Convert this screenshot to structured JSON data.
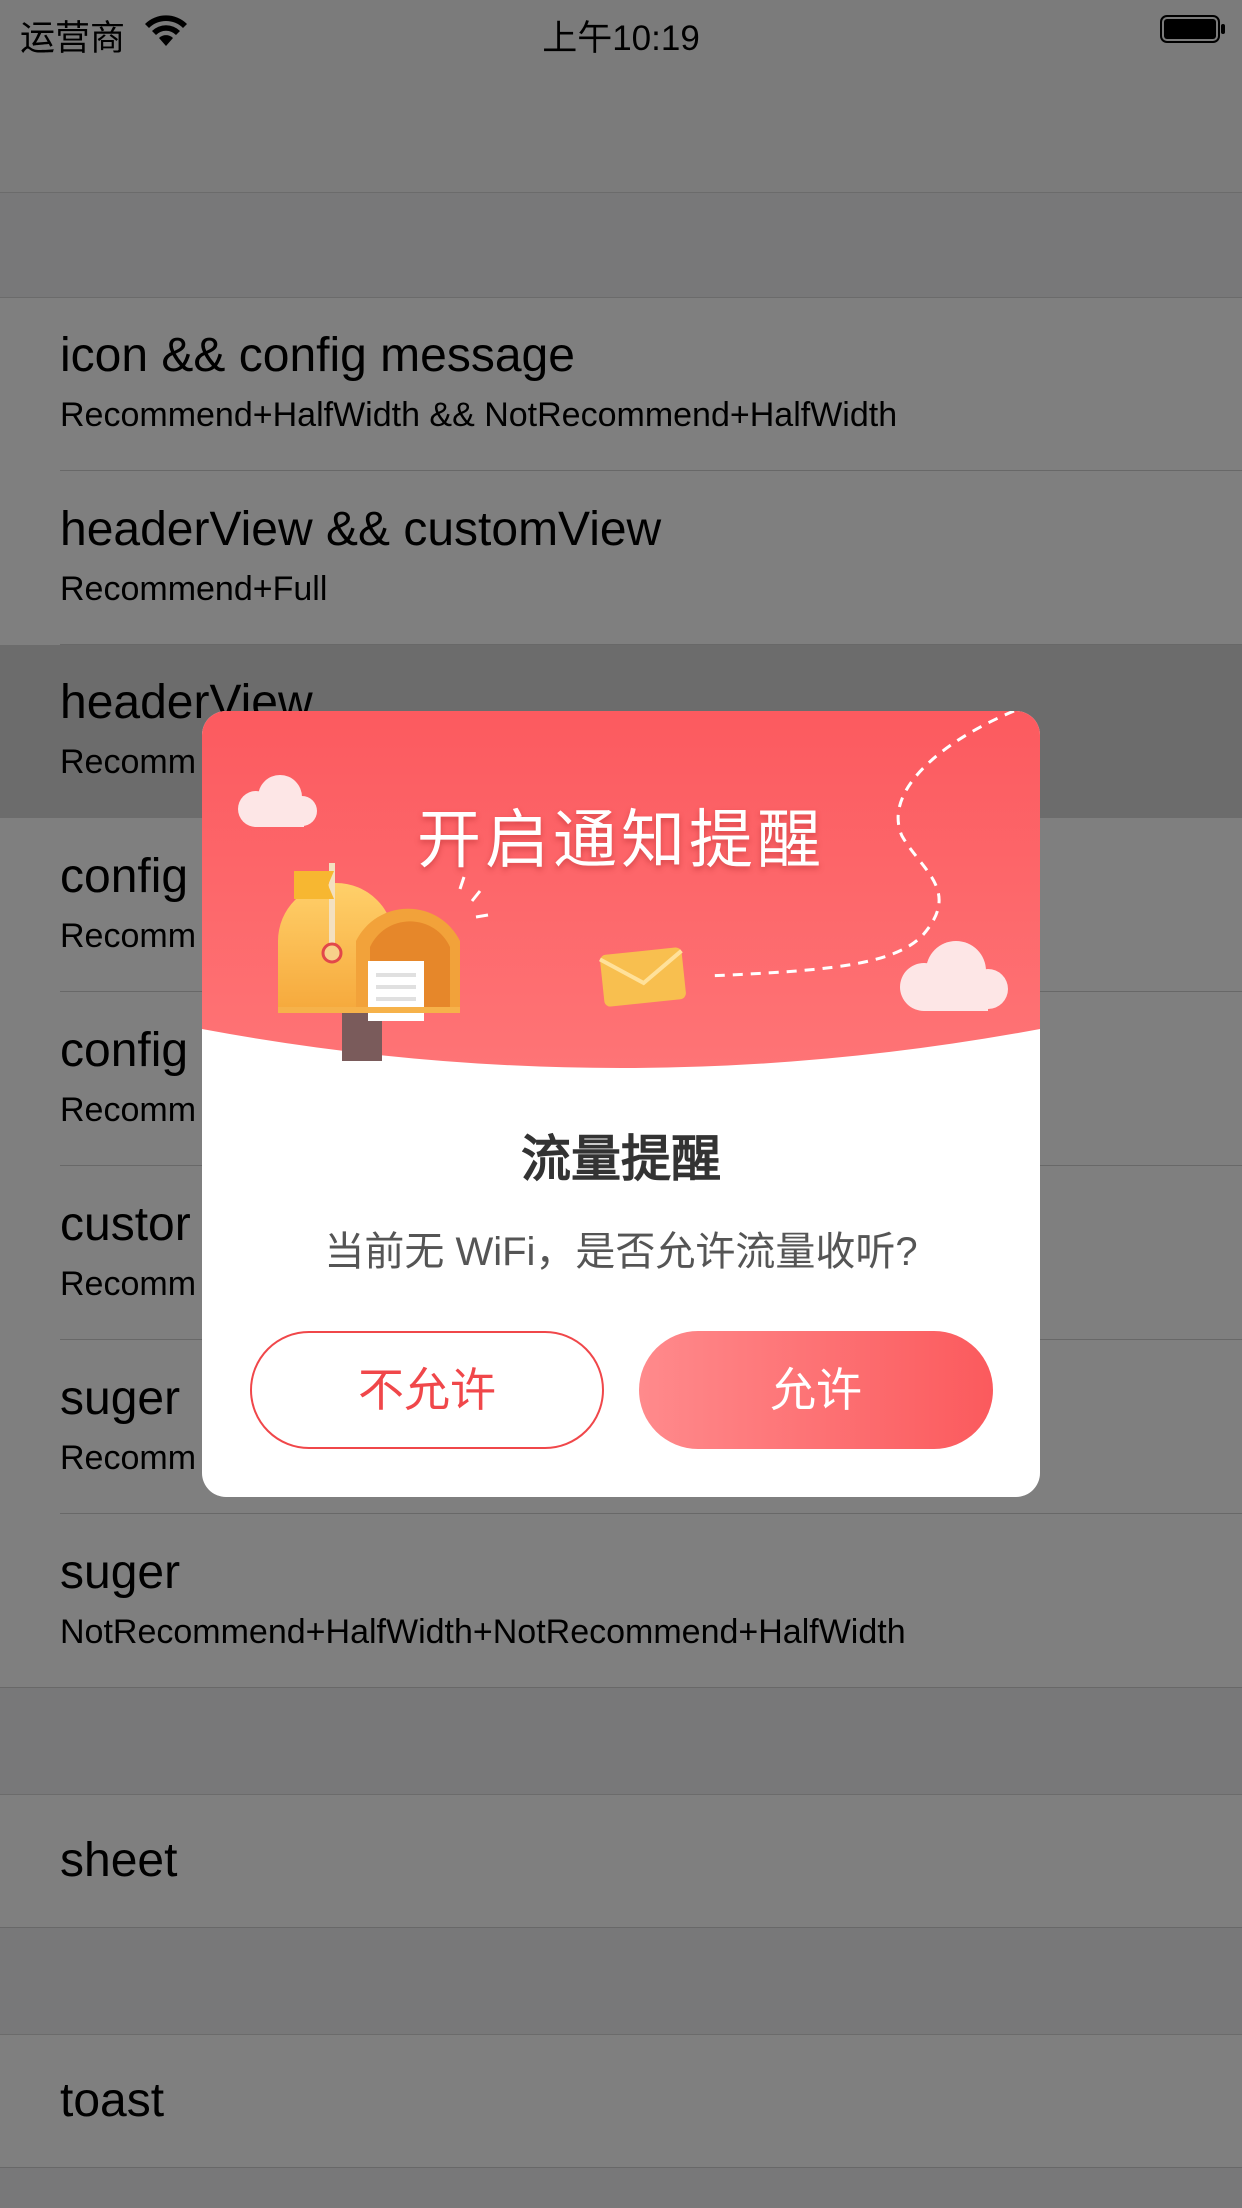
{
  "status_bar": {
    "carrier": "运营商",
    "time": "上午10:19"
  },
  "sections": [
    {
      "rows": [
        {
          "title": "icon && config message",
          "subtitle": "Recommend+HalfWidth && NotRecommend+HalfWidth"
        },
        {
          "title": "headerView && customView",
          "subtitle": "Recommend+Full"
        },
        {
          "title": "headerView",
          "subtitle": "Recomm"
        },
        {
          "title": "config",
          "subtitle": "Recomm"
        },
        {
          "title": "config",
          "subtitle": "Recomm"
        },
        {
          "title": "custor",
          "subtitle": "Recomm"
        },
        {
          "title": "suger",
          "subtitle": "Recomm"
        },
        {
          "title": "suger",
          "subtitle": "NotRecommend+HalfWidth+NotRecommend+HalfWidth"
        }
      ]
    },
    {
      "rows": [
        {
          "title": "sheet"
        }
      ]
    },
    {
      "rows": [
        {
          "title": "toast"
        }
      ]
    }
  ],
  "dialog": {
    "header_title": "开启通知提醒",
    "title": "流量提醒",
    "message": "当前无 WiFi，是否允许流量收听?",
    "deny_label": "不允许",
    "allow_label": "允许"
  },
  "colors": {
    "accent": "#f0474a",
    "header_gradient_top": "#fc5a5f",
    "header_gradient_bottom": "#fe7476",
    "overlay": "rgba(0,0,0,0.5)"
  },
  "icons": [
    "wifi-icon",
    "battery-icon",
    "mailbox-icon",
    "envelope-icon",
    "cloud-icon",
    "flag-icon"
  ]
}
